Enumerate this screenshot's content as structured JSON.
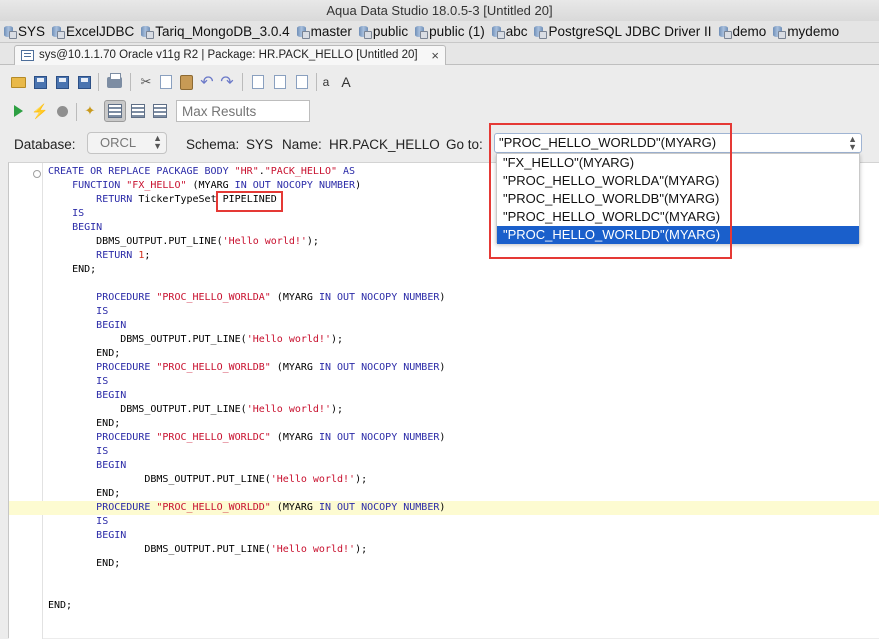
{
  "window": {
    "title": "Aqua Data Studio 18.0.5-3 [Untitled 20]"
  },
  "bookmarks": [
    "SYS",
    "ExcelJDBC",
    "Tariq_MongoDB_3.0.4",
    "master",
    "public",
    "public (1)",
    "abc",
    "PostgreSQL JDBC Driver II",
    "demo",
    "mydemo"
  ],
  "tab": {
    "label": "sys@10.1.1.70 Oracle  v11g R2 | Package: HR.PACK_HELLO [Untitled 20]",
    "close": "×"
  },
  "toolbar": {
    "max_results_placeholder": "Max Results",
    "font_decrease": "a",
    "font_increase": "A"
  },
  "dbbar": {
    "database_label": "Database:",
    "database_value": "ORCL",
    "schema_label": "Schema:",
    "schema_value": "SYS",
    "name_label": "Name:",
    "name_value": "HR.PACK_HELLO",
    "goto_label": "Go to:",
    "goto_value": "\"PROC_HELLO_WORLDD\"(MYARG)",
    "goto_options": [
      "\"FX_HELLO\"(MYARG)",
      "\"PROC_HELLO_WORLDA\"(MYARG)",
      "\"PROC_HELLO_WORLDB\"(MYARG)",
      "\"PROC_HELLO_WORLDC\"(MYARG)",
      "\"PROC_HELLO_WORLDD\"(MYARG)"
    ],
    "goto_selected_index": 4
  },
  "editor": {
    "highlight_line": 25,
    "code_lines": [
      [
        [
          "kw",
          "CREATE OR REPLACE PACKAGE BODY "
        ],
        [
          "str",
          "\"HR\""
        ],
        [
          "t",
          "."
        ],
        [
          "str",
          "\"PACK_HELLO\""
        ],
        [
          "kw",
          " AS"
        ]
      ],
      [
        [
          "t",
          "    "
        ],
        [
          "kw",
          "FUNCTION "
        ],
        [
          "str",
          "\"FX_HELLO\""
        ],
        [
          "t",
          " (MYARG "
        ],
        [
          "kw",
          "IN OUT NOCOPY NUMBER"
        ],
        [
          "t",
          ")"
        ]
      ],
      [
        [
          "t",
          "        "
        ],
        [
          "kw",
          "RETURN"
        ],
        [
          "t",
          " TickerTypeSet "
        ],
        [
          "t",
          "PIPELINED"
        ]
      ],
      [
        [
          "t",
          "    "
        ],
        [
          "kw",
          "IS"
        ]
      ],
      [
        [
          "t",
          "    "
        ],
        [
          "kw",
          "BEGIN"
        ]
      ],
      [
        [
          "t",
          "        DBMS_OUTPUT.PUT_LINE("
        ],
        [
          "str",
          "'Hello world!'"
        ],
        [
          "t",
          ");"
        ]
      ],
      [
        [
          "t",
          "        "
        ],
        [
          "kw",
          "RETURN "
        ],
        [
          "num",
          "1"
        ],
        [
          "t",
          ";"
        ]
      ],
      [
        [
          "t",
          "    END;"
        ]
      ],
      [
        [
          "t",
          ""
        ]
      ],
      [
        [
          "t",
          "        "
        ],
        [
          "kw",
          "PROCEDURE "
        ],
        [
          "str",
          "\"PROC_HELLO_WORLDA\""
        ],
        [
          "t",
          " (MYARG "
        ],
        [
          "kw",
          "IN OUT NOCOPY NUMBER"
        ],
        [
          "t",
          ")"
        ]
      ],
      [
        [
          "t",
          "        "
        ],
        [
          "kw",
          "IS"
        ]
      ],
      [
        [
          "t",
          "        "
        ],
        [
          "kw",
          "BEGIN"
        ]
      ],
      [
        [
          "t",
          "            DBMS_OUTPUT.PUT_LINE("
        ],
        [
          "str",
          "'Hello world!'"
        ],
        [
          "t",
          ");"
        ]
      ],
      [
        [
          "t",
          "        END;"
        ]
      ],
      [
        [
          "t",
          "        "
        ],
        [
          "kw",
          "PROCEDURE "
        ],
        [
          "str",
          "\"PROC_HELLO_WORLDB\""
        ],
        [
          "t",
          " (MYARG "
        ],
        [
          "kw",
          "IN OUT NOCOPY NUMBER"
        ],
        [
          "t",
          ")"
        ]
      ],
      [
        [
          "t",
          "        "
        ],
        [
          "kw",
          "IS"
        ]
      ],
      [
        [
          "t",
          "        "
        ],
        [
          "kw",
          "BEGIN"
        ]
      ],
      [
        [
          "t",
          "            DBMS_OUTPUT.PUT_LINE("
        ],
        [
          "str",
          "'Hello world!'"
        ],
        [
          "t",
          ");"
        ]
      ],
      [
        [
          "t",
          "        END;"
        ]
      ],
      [
        [
          "t",
          "        "
        ],
        [
          "kw",
          "PROCEDURE "
        ],
        [
          "str",
          "\"PROC_HELLO_WORLDC\""
        ],
        [
          "t",
          " (MYARG "
        ],
        [
          "kw",
          "IN OUT NOCOPY NUMBER"
        ],
        [
          "t",
          ")"
        ]
      ],
      [
        [
          "t",
          "        "
        ],
        [
          "kw",
          "IS"
        ]
      ],
      [
        [
          "t",
          "        "
        ],
        [
          "kw",
          "BEGIN"
        ]
      ],
      [
        [
          "t",
          "                DBMS_OUTPUT.PUT_LINE("
        ],
        [
          "str",
          "'Hello world!'"
        ],
        [
          "t",
          ");"
        ]
      ],
      [
        [
          "t",
          "        END;"
        ]
      ],
      [
        [
          "t",
          "        "
        ],
        [
          "kw",
          "PROCEDURE "
        ],
        [
          "str",
          "\"PROC_HELLO_WORLDD\""
        ],
        [
          "t",
          " (MYARG "
        ],
        [
          "kw",
          "IN OUT NOCOPY NUMBER"
        ],
        [
          "t",
          ")"
        ]
      ],
      [
        [
          "t",
          "        "
        ],
        [
          "kw",
          "IS"
        ]
      ],
      [
        [
          "t",
          "        "
        ],
        [
          "kw",
          "BEGIN"
        ]
      ],
      [
        [
          "t",
          "                DBMS_OUTPUT.PUT_LINE("
        ],
        [
          "str",
          "'Hello world!'"
        ],
        [
          "t",
          ");"
        ]
      ],
      [
        [
          "t",
          "        END;"
        ]
      ],
      [
        [
          "t",
          ""
        ]
      ],
      [
        [
          "t",
          ""
        ]
      ],
      [
        [
          "t",
          "END;"
        ]
      ]
    ]
  },
  "colors": {
    "selection": "#1a5fcb",
    "annotation_red": "#e53935",
    "line_highlight": "#fdfbd1",
    "keyword": "#2b2ba8",
    "string": "#c8102e"
  }
}
